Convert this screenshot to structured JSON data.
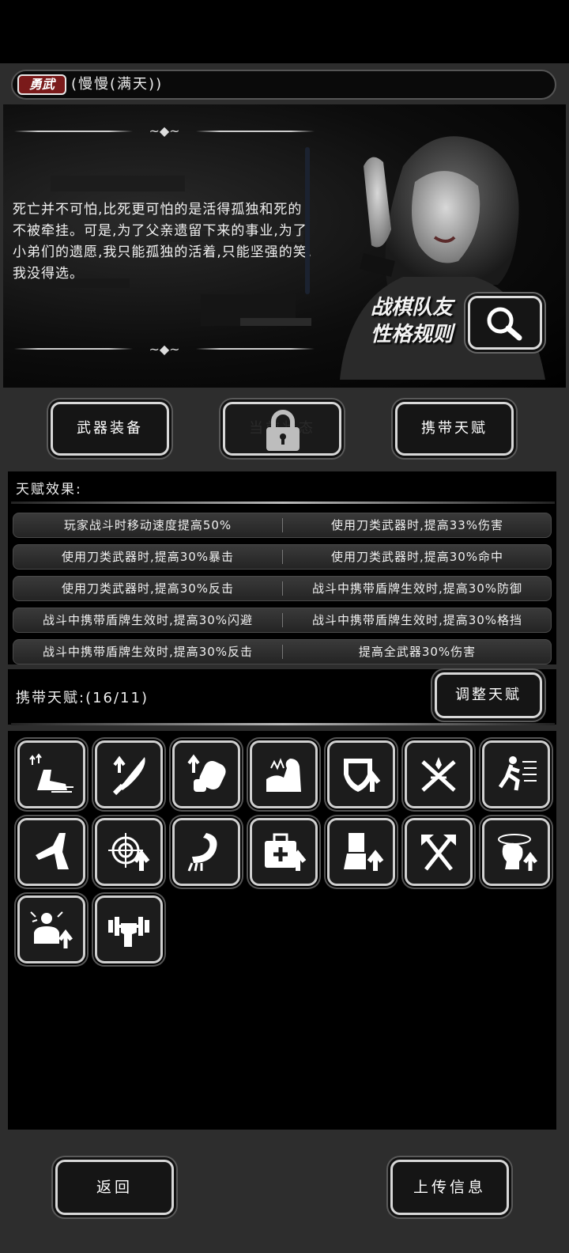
{
  "header": {
    "badge": "勇武",
    "character_name": "(慢慢(满天))"
  },
  "story": {
    "text": "死亡并不可怕,比死更可怕的是活得孤独和死的不被牵挂。可是,为了父亲遗留下来的事业,为了小弟们的遗愿,我只能孤独的活着,只能坚强的笑,我没得选。",
    "rule_line1": "战棋队友",
    "rule_line2": "性格规则"
  },
  "buttons": {
    "weapon_equip": "武器装备",
    "locked_label": "当前状态",
    "carry_talent": "携带天赋",
    "adjust_talent": "调整天赋",
    "back": "返回",
    "upload": "上传信息"
  },
  "talent_effect": {
    "title": "天赋效果:",
    "rows": [
      [
        "玩家战斗时移动速度提高50%",
        "使用刀类武器时,提高33%伤害"
      ],
      [
        "使用刀类武器时,提高30%暴击",
        "使用刀类武器时,提高30%命中"
      ],
      [
        "使用刀类武器时,提高30%反击",
        "战斗中携带盾牌生效时,提高30%防御"
      ],
      [
        "战斗中携带盾牌生效时,提高30%闪避",
        "战斗中携带盾牌生效时,提高30%格挡"
      ],
      [
        "战斗中携带盾牌生效时,提高30%反击",
        "提高全武器30%伤害"
      ]
    ]
  },
  "carried": {
    "label": "携带天赋:(16/11)"
  },
  "talent_icons": [
    "speed-boot-icon",
    "blade-up-icon",
    "fist-up-icon",
    "flexed-arm-icon",
    "shield-up-icon",
    "crossed-swords-icon",
    "running-man-icon",
    "leg-kick-icon",
    "target-up-icon",
    "hook-arm-icon",
    "medkit-up-icon",
    "armor-legs-up-icon",
    "crossed-axes-icon",
    "dizzy-head-up-icon",
    "angry-man-up-icon",
    "dumbbell-grip-icon"
  ]
}
